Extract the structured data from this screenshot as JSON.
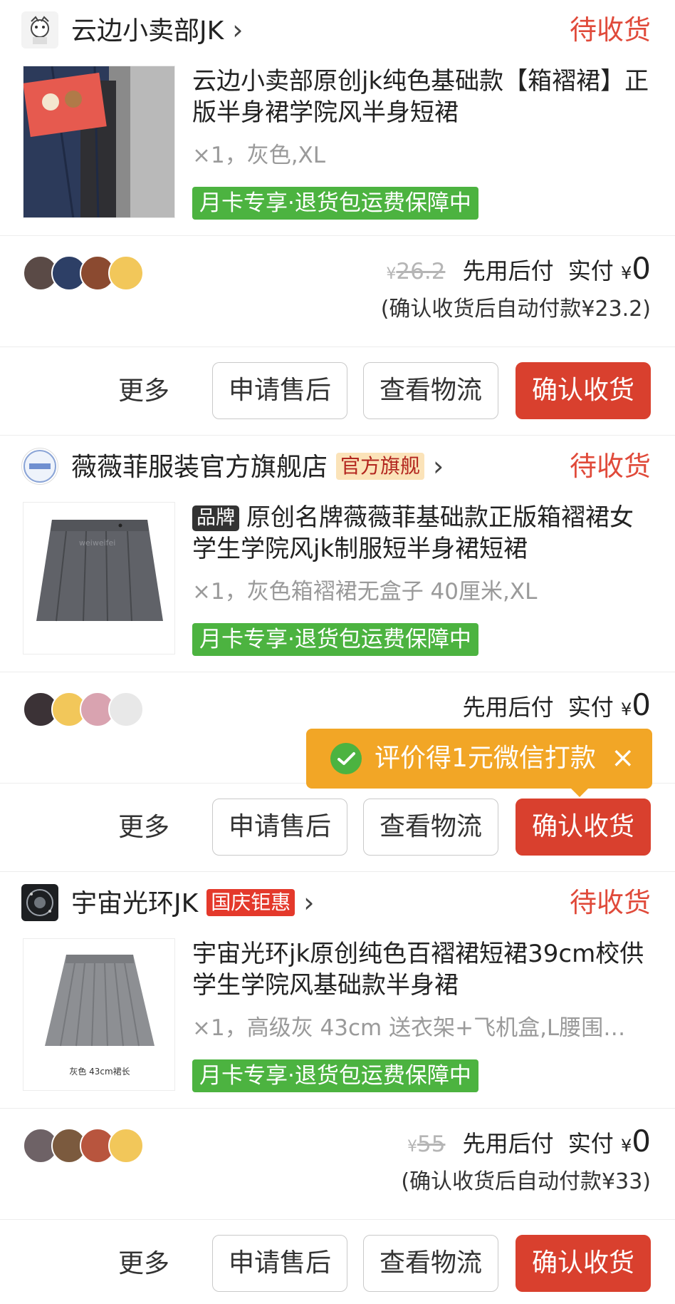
{
  "orders": [
    {
      "shop_name": "云边小卖部JK",
      "shop_badge": "",
      "status": "待收货",
      "title": "云边小卖部原创jk纯色基础款【箱褶裙】正版半身裙学院风半身短裙",
      "brand_tag": "",
      "spec": "×1，灰色,XL",
      "tag": "月卡专享·退货包运费保障中",
      "original_price_currency": "¥",
      "original_price": "26.2",
      "pay_later": "先用后付",
      "paid_label": "实付",
      "paid_currency": "¥",
      "paid_amount": "0",
      "auto_pay_note": "(确认收货后自动付款¥23.2)",
      "actions": {
        "more": "更多",
        "after_sale": "申请售后",
        "logistics": "查看物流",
        "confirm": "确认收货"
      }
    },
    {
      "shop_name": "薇薇菲服装官方旗舰店",
      "shop_badge": "官方旗舰",
      "status": "待收货",
      "title": "原创名牌薇薇菲基础款正版箱褶裙女学生学院风jk制服短半身裙短裙",
      "brand_tag": "品牌",
      "spec": "×1，灰色箱褶裙无盒子 40厘米,XL",
      "tag": "月卡专享·退货包运费保障中",
      "image_watermark": "weiweifei",
      "original_price_currency": "",
      "original_price": "",
      "pay_later": "先用后付",
      "paid_label": "实付",
      "paid_currency": "¥",
      "paid_amount": "0",
      "auto_pay_note": "",
      "actions": {
        "more": "更多",
        "after_sale": "申请售后",
        "logistics": "查看物流",
        "confirm": "确认收货"
      }
    },
    {
      "shop_name": "宇宙光环JK",
      "shop_badge": "国庆钜惠",
      "status": "待收货",
      "title": "宇宙光环jk原创纯色百褶裙短裙39cm校供学生学院风基础款半身裙",
      "brand_tag": "",
      "spec": "×1，高级灰 43cm 送衣架+飞机盒,L腰围…",
      "tag": "月卡专享·退货包运费保障中",
      "image_caption": "灰色 43cm裙长",
      "original_price_currency": "¥",
      "original_price": "55",
      "pay_later": "先用后付",
      "paid_label": "实付",
      "paid_currency": "¥",
      "paid_amount": "0",
      "auto_pay_note": "(确认收货后自动付款¥33)",
      "actions": {
        "more": "更多",
        "after_sale": "申请售后",
        "logistics": "查看物流",
        "confirm": "确认收货"
      }
    }
  ],
  "tooltip": {
    "text": "评价得1元微信打款",
    "icon": "wechat-pay-check-icon",
    "close": "×"
  },
  "colors": {
    "status": "#e04a3a",
    "primary_button": "#d9402e",
    "green_tag": "#4cb340",
    "tooltip": "#f2a626"
  }
}
